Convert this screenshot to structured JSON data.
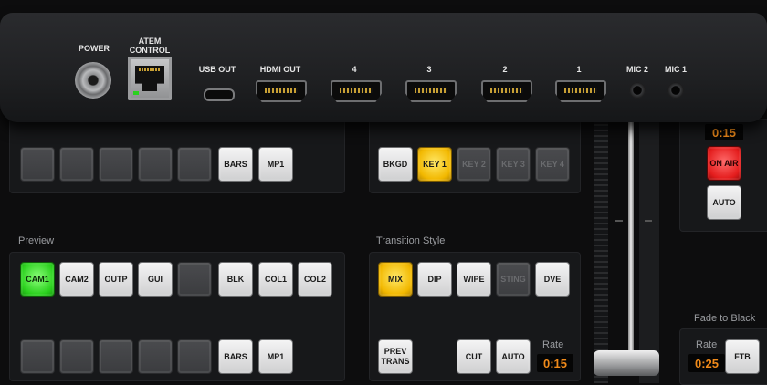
{
  "device": {
    "ports": [
      {
        "label": "POWER"
      },
      {
        "label": "ATEM CONTROL"
      },
      {
        "label": "USB OUT"
      },
      {
        "label": "HDMI OUT"
      },
      {
        "label": "4"
      },
      {
        "label": "3"
      },
      {
        "label": "2"
      },
      {
        "label": "1"
      },
      {
        "label": "MIC 2"
      },
      {
        "label": "MIC 1"
      }
    ]
  },
  "program_row": {
    "buttons": [
      "BARS",
      "MP1"
    ]
  },
  "keyers": {
    "buttons": [
      "BKGD",
      "KEY 1",
      "KEY 2",
      "KEY 3",
      "KEY 4"
    ]
  },
  "preview": {
    "label": "Preview",
    "buttons": [
      "CAM1",
      "CAM2",
      "OUTP",
      "GUI",
      "BLK",
      "COL1",
      "COL2"
    ],
    "lower_buttons": [
      "BARS",
      "MP1"
    ]
  },
  "transition_style": {
    "label": "Transition Style",
    "buttons": [
      "MIX",
      "DIP",
      "WIPE",
      "STING",
      "DVE"
    ],
    "prev_trans": "PREV TRANS",
    "cut": "CUT",
    "auto": "AUTO",
    "rate_label": "Rate",
    "rate_value": "0:15"
  },
  "right_panel": {
    "top_rate_value": "0:15",
    "on_air": "ON AIR",
    "auto": "AUTO"
  },
  "fade_to_black": {
    "label": "Fade to Black",
    "rate_label": "Rate",
    "rate_value": "0:25",
    "ftb": "FTB"
  },
  "colors": {
    "tally_green": "#2bd11e",
    "tally_yellow": "#f2b800",
    "tally_red": "#e41d1d",
    "rate_orange": "#f08a1a"
  }
}
